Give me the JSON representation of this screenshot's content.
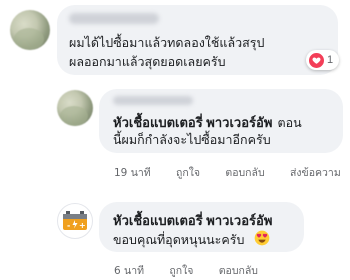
{
  "comment1": {
    "text_line1": "ผมได้ไปซื้อมาแล้วทดลองใช้แล้วสรุป",
    "text_line2": "ผลออกมาแล้วสุดยอดเลยครับ",
    "reaction_count": "1",
    "reaction_icon": "heart-icon"
  },
  "reply1": {
    "author": "หัวเชื้อแบตเตอรี่ พาวเวอร์อัพ",
    "text_line1_tail": "ตอน",
    "text_line2": "นี้ผมก็กำลังจะไปซื้อมาอีกครับ",
    "time": "19 นาที",
    "like_label": "ถูกใจ",
    "reply_label": "ตอบกลับ",
    "message_label": "ส่งข้อความ"
  },
  "reply2": {
    "author": "หัวเชื้อแบตเตอรี่ พาวเวอร์อัพ",
    "text": "ขอบคุณที่อุดหนุนนะครับ",
    "emoji": "heart-eyes-emoji",
    "time": "6 นาที",
    "like_label": "ถูกใจ",
    "reply_label": "ตอบกลับ"
  },
  "colors": {
    "bubble": "#f0f2f5",
    "meta_text": "#65676b",
    "heart": "#f33e58",
    "battery_orange": "#f0a01e"
  }
}
